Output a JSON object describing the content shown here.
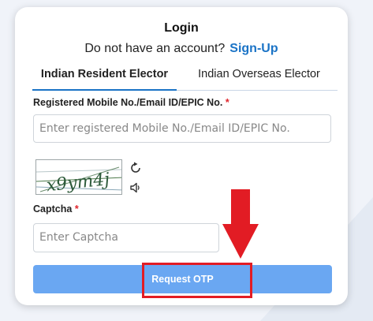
{
  "login": {
    "title": "Login",
    "no_account_text": "Do not have an account?",
    "signup_link": "Sign-Up"
  },
  "tabs": [
    {
      "label": "Indian Resident Elector",
      "active": true
    },
    {
      "label": "Indian Overseas Elector",
      "active": false
    }
  ],
  "form": {
    "identifier_label": "Registered Mobile No./Email ID/EPIC No.",
    "identifier_placeholder": "Enter registered Mobile No./Email ID/EPIC No.",
    "required_mark": "*",
    "captcha_image_text": "x9ym4j",
    "captcha_label": "Captcha",
    "captcha_placeholder": "Enter Captcha",
    "submit_label": "Request OTP"
  },
  "icons": {
    "refresh": "refresh-icon",
    "audio": "speaker-icon",
    "annotation": "red-down-arrow"
  },
  "colors": {
    "accent": "#1a73c6",
    "button": "#6aa7f2",
    "required": "#e0242b",
    "highlight": "#e21c24"
  }
}
